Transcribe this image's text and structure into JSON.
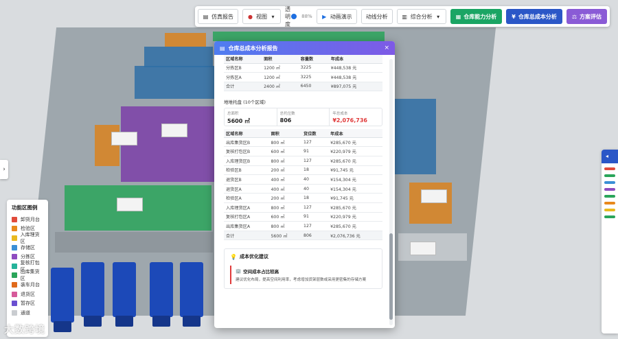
{
  "toolbar": {
    "report": "仿真报告",
    "view": "视图",
    "opacity_label": "透明度",
    "opacity_value": "88%",
    "animation": "动画演示",
    "flow": "动线分析",
    "analysis": "综合分析",
    "capacity": "仓库能力分析",
    "total_cost": "仓库总成本分析",
    "plan_eval": "方案评估"
  },
  "legend": {
    "title": "功能区图例",
    "items": [
      {
        "label": "卸货月台",
        "color": "#e14b3b"
      },
      {
        "label": "检验区",
        "color": "#e8891c"
      },
      {
        "label": "入库理货区",
        "color": "#e9b91f"
      },
      {
        "label": "存储区",
        "color": "#3a8fd6"
      },
      {
        "label": "分拣区",
        "color": "#8e4cc0"
      },
      {
        "label": "复核打包区",
        "color": "#25b39a"
      },
      {
        "label": "出库集货区",
        "color": "#2aa55a"
      },
      {
        "label": "装车月台",
        "color": "#e06a1c"
      },
      {
        "label": "退货区",
        "color": "#d65a9a"
      },
      {
        "label": "暂存区",
        "color": "#6a4fd0"
      },
      {
        "label": "通道",
        "color": "#c9ccd0"
      }
    ]
  },
  "watermark": "大数跨境",
  "modal": {
    "title": "仓库总成本分析报告",
    "close": "×",
    "table1": {
      "headers": [
        "区域名称",
        "面积",
        "容量数",
        "年成本"
      ],
      "rows": [
        [
          "分拣区B",
          "1200 ㎡",
          "3225",
          "¥448,538 元"
        ],
        [
          "分拣区A",
          "1200 ㎡",
          "3225",
          "¥448,538 元"
        ],
        [
          "合计",
          "2400 ㎡",
          "6450",
          "¥897,075 元"
        ]
      ]
    },
    "section2_title": "地堆托盘 (10个区域)",
    "stats": [
      {
        "label": "总面积",
        "value": "5600 ㎡"
      },
      {
        "label": "总托位数",
        "value": "806"
      },
      {
        "label": "年总成本",
        "value": "¥2,076,736"
      }
    ],
    "table2": {
      "headers": [
        "区域名称",
        "面积",
        "货位数",
        "年成本"
      ],
      "rows": [
        [
          "出库集货区B",
          "800 ㎡",
          "127",
          "¥285,670 元"
        ],
        [
          "复核打包区B",
          "600 ㎡",
          "91",
          "¥220,979 元"
        ],
        [
          "入库理货区B",
          "800 ㎡",
          "127",
          "¥285,670 元"
        ],
        [
          "检验区B",
          "200 ㎡",
          "18",
          "¥91,745 元"
        ],
        [
          "退货区B",
          "400 ㎡",
          "40",
          "¥154,304 元"
        ],
        [
          "退货区A",
          "400 ㎡",
          "40",
          "¥154,304 元"
        ],
        [
          "检验区A",
          "200 ㎡",
          "18",
          "¥91,745 元"
        ],
        [
          "入库理货区A",
          "800 ㎡",
          "127",
          "¥285,670 元"
        ],
        [
          "复核打包区A",
          "600 ㎡",
          "91",
          "¥220,979 元"
        ],
        [
          "出库集货区A",
          "800 ㎡",
          "127",
          "¥285,670 元"
        ],
        [
          "合计",
          "5600 ㎡",
          "806",
          "¥2,076,736 元"
        ]
      ]
    },
    "suggest_title": "成本优化建议",
    "tip_title": "空间成本占比较高",
    "tip_text": "建议优化布局，提高空间利用率，考虑增加货架层数或采用更密集的存储方案"
  },
  "colors": {
    "accent": "#2b57c7",
    "header_gradient_start": "#4f7df0",
    "header_gradient_end": "#7e5ae6",
    "cost_red": "#e03a3a"
  }
}
